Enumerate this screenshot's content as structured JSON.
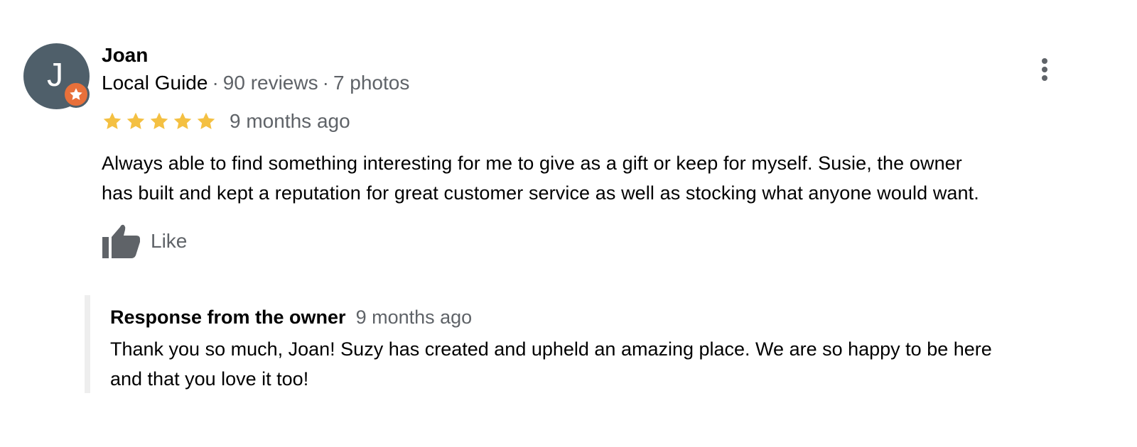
{
  "review": {
    "avatar_letter": "J",
    "author_name": "Joan",
    "author_level": "Local Guide",
    "author_reviews": "90 reviews",
    "author_photos": "7 photos",
    "meta_separator": "·",
    "rating": 5,
    "rating_max": 5,
    "date": "9 months ago",
    "text_line1": "Always able to find something interesting for me to give as a gift or keep for myself.  Susie, the owner",
    "text_line2": "has built and kept a reputation for great customer service as well as stocking what anyone would want.",
    "like_label": "Like",
    "icons": {
      "more": "more-vertical-icon",
      "like": "thumbs-up-icon",
      "star": "star-icon",
      "badge": "local-guide-badge-icon"
    }
  },
  "owner_response": {
    "title": "Response from the owner",
    "date": "9 months ago",
    "text_line1": "Thank you so much, Joan! Suzy has created and upheld an amazing place. We are so happy to be here",
    "text_line2": "and that you love it too!"
  },
  "colors": {
    "avatar_bg": "#4f5f6a",
    "badge": "#e8703a",
    "star": "#f4c042",
    "secondary_text": "#5f6368",
    "icon": "#5f6368",
    "response_border": "#eeeeee"
  }
}
